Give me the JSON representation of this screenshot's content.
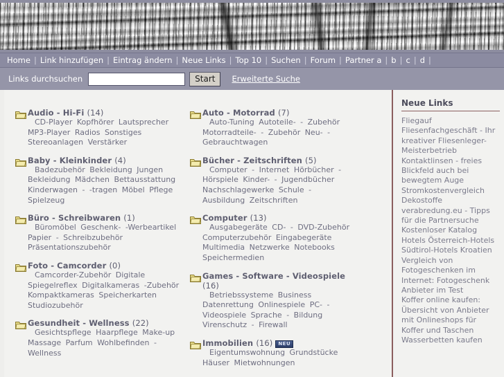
{
  "banner": {
    "alt": "weathered wood grain banner"
  },
  "nav": {
    "items": [
      {
        "label": "Home"
      },
      {
        "label": "Link hinzufügen"
      },
      {
        "label": "Eintrag ändern"
      },
      {
        "label": "Neue Links"
      },
      {
        "label": "Top 10"
      },
      {
        "label": "Suchen"
      },
      {
        "label": "Forum"
      },
      {
        "label": "Partner a"
      },
      {
        "label": "b"
      },
      {
        "label": "c"
      },
      {
        "label": "d"
      }
    ],
    "separator": "|"
  },
  "search": {
    "label": "Links durchsuchen",
    "value": "",
    "placeholder": "",
    "button": "Start",
    "advanced": "Erweiterte Suche"
  },
  "categories_left": [
    {
      "name": "Audio - Hi-Fi",
      "count": "(14)",
      "new": false,
      "subcats": "CD-Player  Kopfhörer  Lautsprecher  MP3-Player  Radios  Sonstiges  Stereoanlagen  Verstärker"
    },
    {
      "name": "Baby - Kleinkinder",
      "count": "(4)",
      "new": false,
      "subcats": "Badezubehör  Bekleidung Jungen  Bekleidung Mädchen  Bettausstattung  Kinderwagen - -tragen  Möbel  Pflege  Spielzeug"
    },
    {
      "name": "Büro - Schreibwaren",
      "count": "(1)",
      "new": false,
      "subcats": "Büromöbel  Geschenk- -Werbeartikel  Papier - Schreibzubehör  Präsentationszubehör"
    },
    {
      "name": "Foto - Camcorder",
      "count": "(0)",
      "new": false,
      "subcats": "Camcorder-Zubehör  Digitale Spiegelreflex  Digitalkameras -Zubehör  Kompaktkameras  Speicherkarten  Studiozubehör"
    },
    {
      "name": "Gesundheit - Wellness",
      "count": "(22)",
      "new": false,
      "subcats": "Gesichtspflege  Haarpflege  Make-up  Massage  Parfum  Wohlbefinden - Wellness"
    }
  ],
  "categories_right": [
    {
      "name": "Auto - Motorrad",
      "count": "(7)",
      "new": false,
      "subcats": "Auto-Tuning  Autoteile- - Zubehör  Motorradteile- - Zubehör  Neu- - Gebrauchtwagen"
    },
    {
      "name": "Bücher - Zeitschriften",
      "count": "(5)",
      "new": false,
      "subcats": "Computer - Internet  Hörbücher - Hörspiele  Kinder- - Jugendbücher  Nachschlagewerke  Schule - Ausbildung  Zeitschriften"
    },
    {
      "name": "Computer",
      "count": "(13)",
      "new": false,
      "subcats": "Ausgabegeräte  CD- - DVD-Zubehör  Computerzubehör  Eingabegeräte  Multimedia  Netzwerke  Notebooks  Speichermedien"
    },
    {
      "name": "Games - Software - Videospiele",
      "count": "(16)",
      "new": false,
      "subcats": "Betriebssysteme  Business  Datenrettung  Onlinespiele  PC- - Videospiele  Sprache - Bildung  Virenschutz - Firewall"
    },
    {
      "name": "Immobilien",
      "count": "(16)",
      "new": true,
      "new_label": "NEU",
      "subcats": "Eigentumswohnung  Grundstücke  Häuser  Mietwohnungen"
    }
  ],
  "sidebar": {
    "title": "Neue Links",
    "links": [
      "Fliegauf Fliesenfachgeschäft - Ihr kreativer Fliesenleger-Meisterbetrieb",
      "Kontaktlinsen - freies Blickfeld auch bei bewegtem Auge",
      "Stromkostenvergleich",
      "Dekostoffe",
      "verabredung.eu - Tipps für die Partnersuche",
      "Kostenloser Katalog",
      "Hotels Österreich-Hotels Südtirol-Hotels Kroatien",
      "Vergleich von Fotogeschenken im Internet: Fotogeschenk Anbieter im Test",
      "Koffer online kaufen: Übersicht von Anbieter mit Onlineshops für Koffer und Taschen",
      "Wasserbetten kaufen"
    ]
  },
  "colors": {
    "navbar": "#8b8ba1",
    "searchbar": "#9595a8",
    "page_bg": "#f2f2f0",
    "category_title": "#5e5e70",
    "subcat_text": "#6d6d80",
    "sidebar_rule": "#8b5e5e",
    "sidebar_link": "#7b7b8c",
    "badge_new": "#2b3d68"
  }
}
